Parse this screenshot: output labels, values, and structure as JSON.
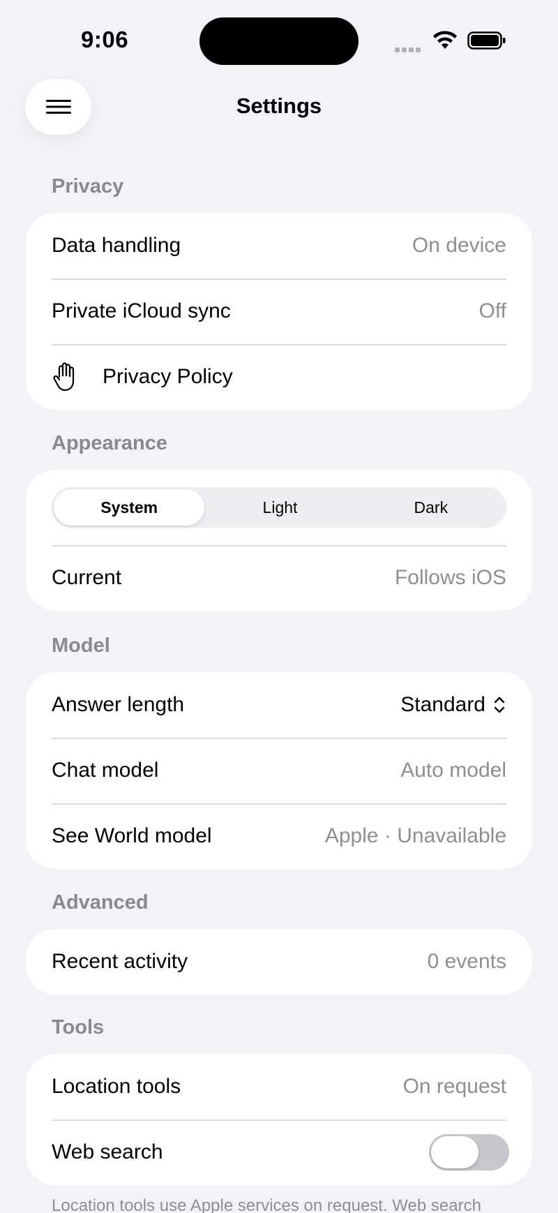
{
  "status_bar": {
    "time": "9:06"
  },
  "header": {
    "title": "Settings"
  },
  "sections": {
    "privacy": {
      "title": "Privacy",
      "rows": [
        {
          "label": "Data handling",
          "value": "On device"
        },
        {
          "label": "Private iCloud sync",
          "value": "Off"
        },
        {
          "label": "Privacy Policy",
          "icon": "hand-raised-icon"
        }
      ]
    },
    "appearance": {
      "title": "Appearance",
      "segments": [
        "System",
        "Light",
        "Dark"
      ],
      "selected_segment": "System",
      "current_label": "Current",
      "current_value": "Follows iOS"
    },
    "model": {
      "title": "Model",
      "rows": [
        {
          "label": "Answer length",
          "value": "Standard"
        },
        {
          "label": "Chat model",
          "value": "Auto model"
        },
        {
          "label": "See World model",
          "value": "Apple · Unavailable"
        }
      ]
    },
    "advanced": {
      "title": "Advanced",
      "rows": [
        {
          "label": "Recent activity",
          "value": "0 events"
        }
      ]
    },
    "tools": {
      "title": "Tools",
      "rows": [
        {
          "label": "Location tools",
          "value": "On request"
        },
        {
          "label": "Web search",
          "toggle_on": false
        }
      ],
      "footnote": "Location tools use Apple services on request. Web search"
    }
  },
  "colors": {
    "background": "#f2f2f7",
    "secondary_text": "#8e8e93",
    "section_header": "#8a8a8e"
  }
}
